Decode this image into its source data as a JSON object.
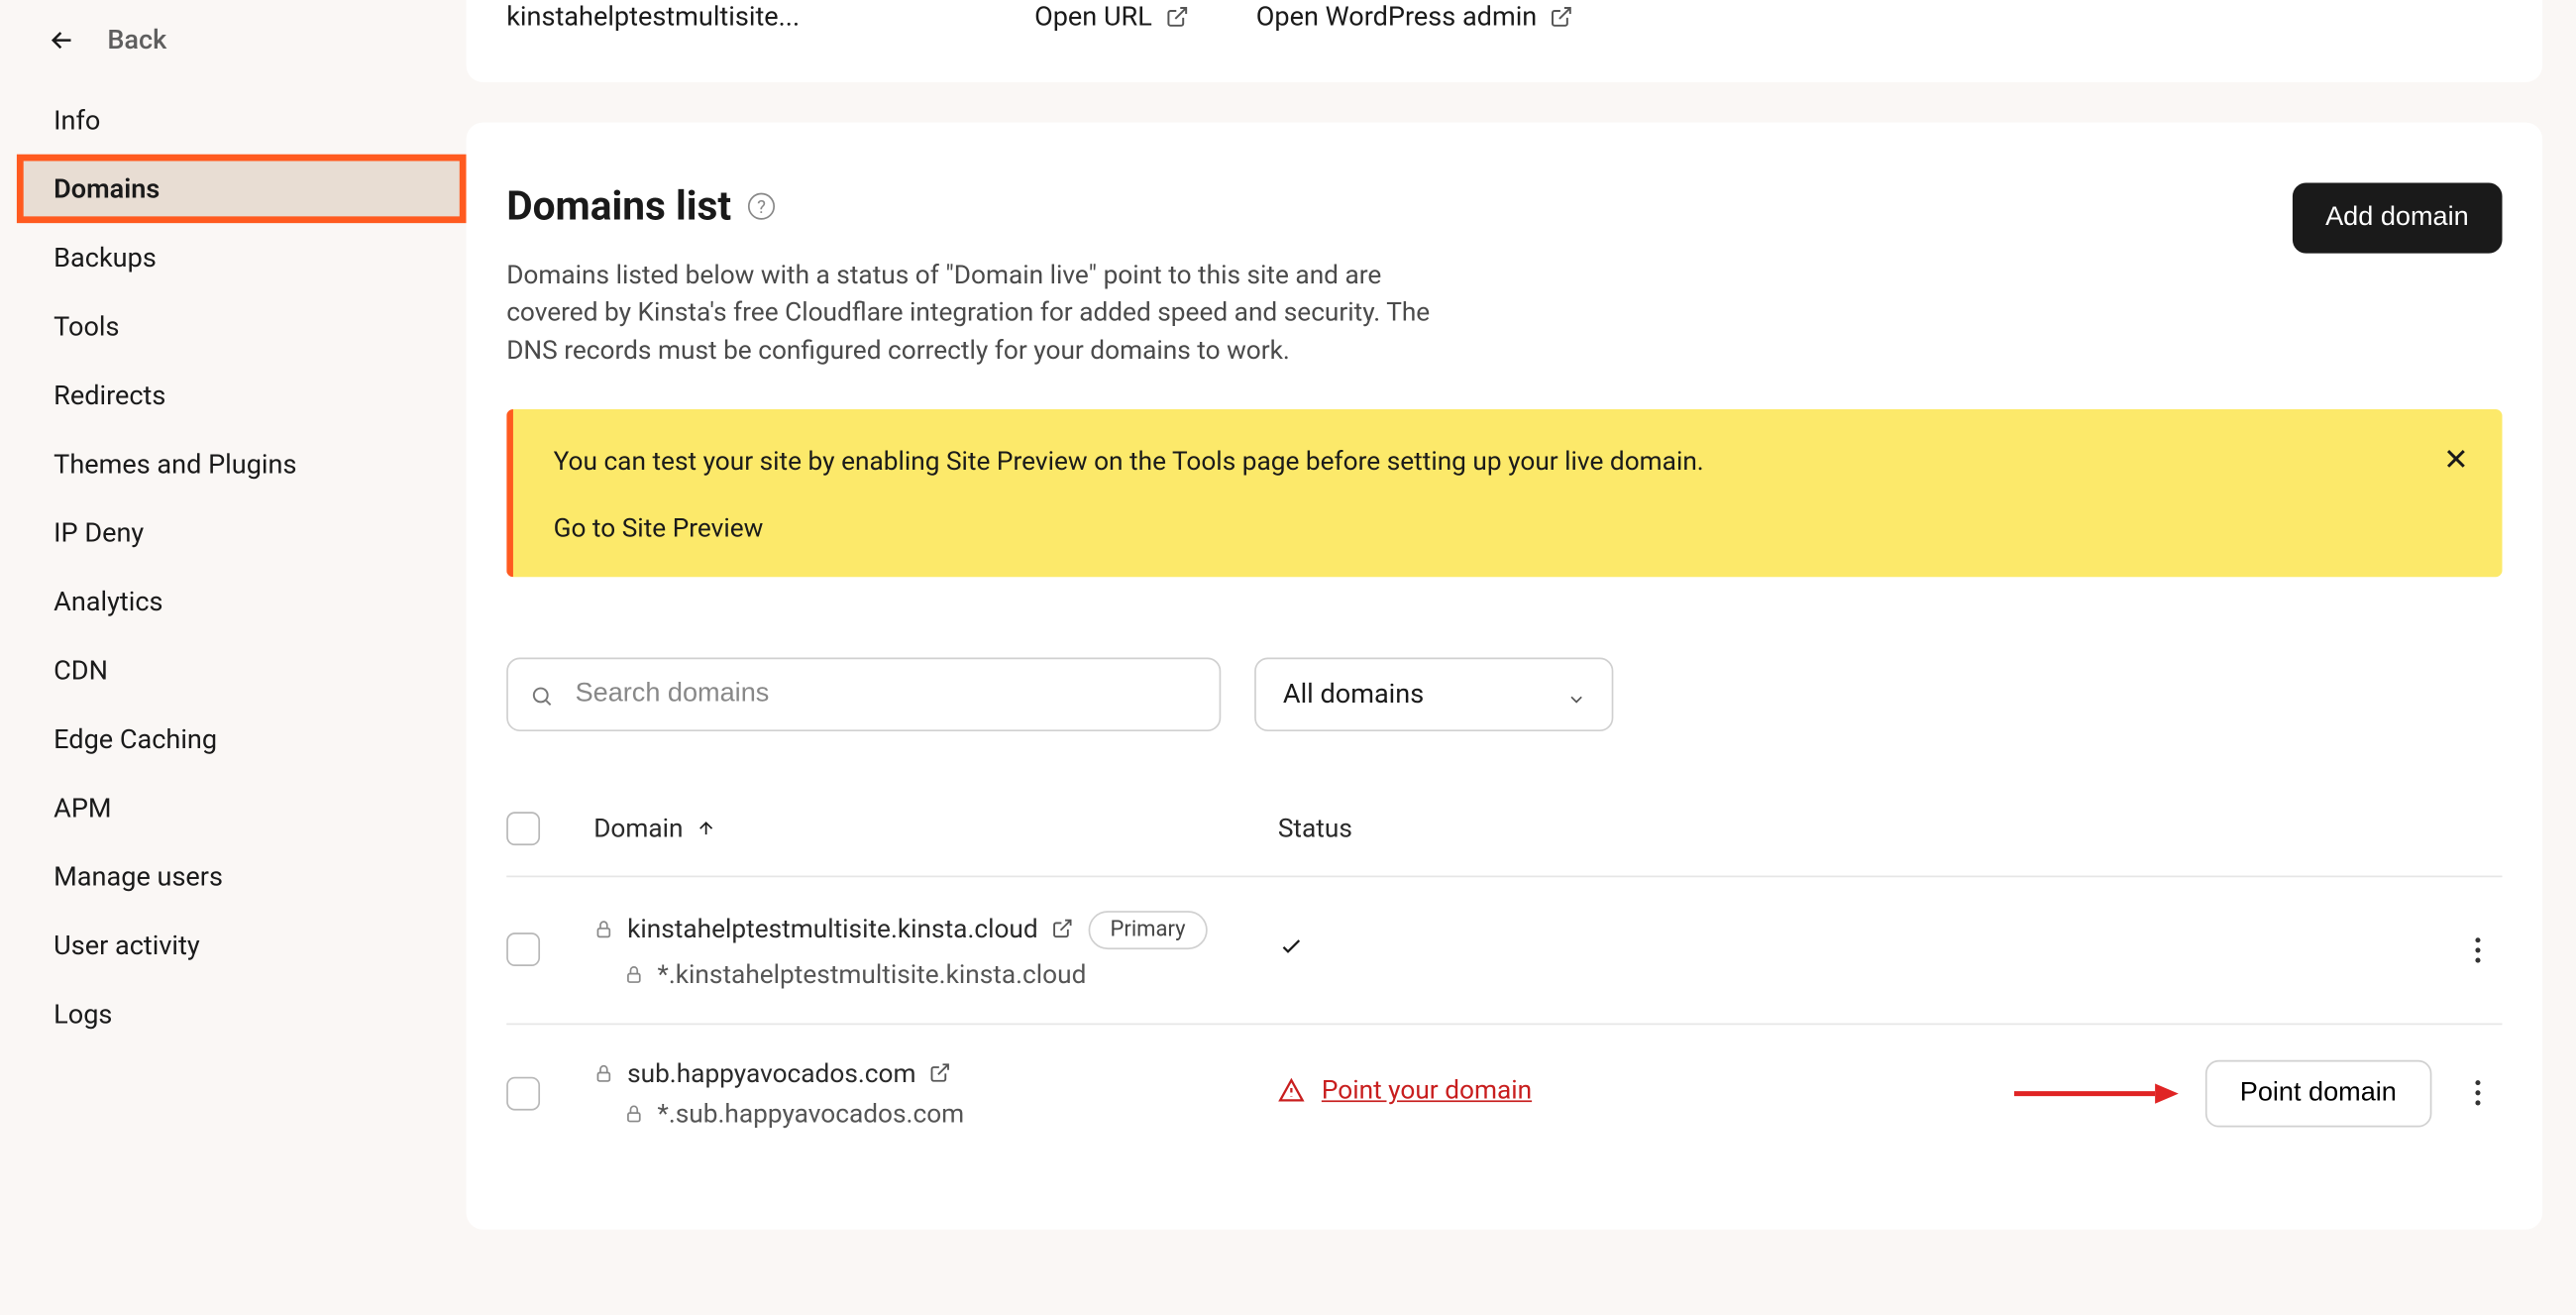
{
  "back_label": "Back",
  "sidebar": {
    "items": [
      {
        "label": "Info"
      },
      {
        "label": "Domains"
      },
      {
        "label": "Backups"
      },
      {
        "label": "Tools"
      },
      {
        "label": "Redirects"
      },
      {
        "label": "Themes and Plugins"
      },
      {
        "label": "IP Deny"
      },
      {
        "label": "Analytics"
      },
      {
        "label": "CDN"
      },
      {
        "label": "Edge Caching"
      },
      {
        "label": "APM"
      },
      {
        "label": "Manage users"
      },
      {
        "label": "User activity"
      },
      {
        "label": "Logs"
      }
    ],
    "active_index": 1
  },
  "topbar": {
    "site_name": "kinstahelptestmultisite...",
    "open_url": "Open URL",
    "open_wp": "Open WordPress admin"
  },
  "panel": {
    "title": "Domains list",
    "description": "Domains listed below with a status of \"Domain live\" point to this site and are covered by Kinsta's free Cloudflare integration for added speed and security. The DNS records must be configured correctly for your domains to work.",
    "add_button": "Add domain"
  },
  "alert": {
    "text": "You can test your site by enabling Site Preview on the Tools page before setting up your live domain.",
    "link": "Go to Site Preview"
  },
  "filters": {
    "search_placeholder": "Search domains",
    "select_value": "All domains"
  },
  "table": {
    "col_domain": "Domain",
    "col_status": "Status",
    "rows": [
      {
        "domain": "kinstahelptestmultisite.kinsta.cloud",
        "wildcard": "*.kinstahelptestmultisite.kinsta.cloud",
        "primary_badge": "Primary",
        "status_type": "ok"
      },
      {
        "domain": "sub.happyavocados.com",
        "wildcard": "*.sub.happyavocados.com",
        "status_type": "warn",
        "status_text": "Point your domain",
        "action_button": "Point domain"
      }
    ]
  }
}
